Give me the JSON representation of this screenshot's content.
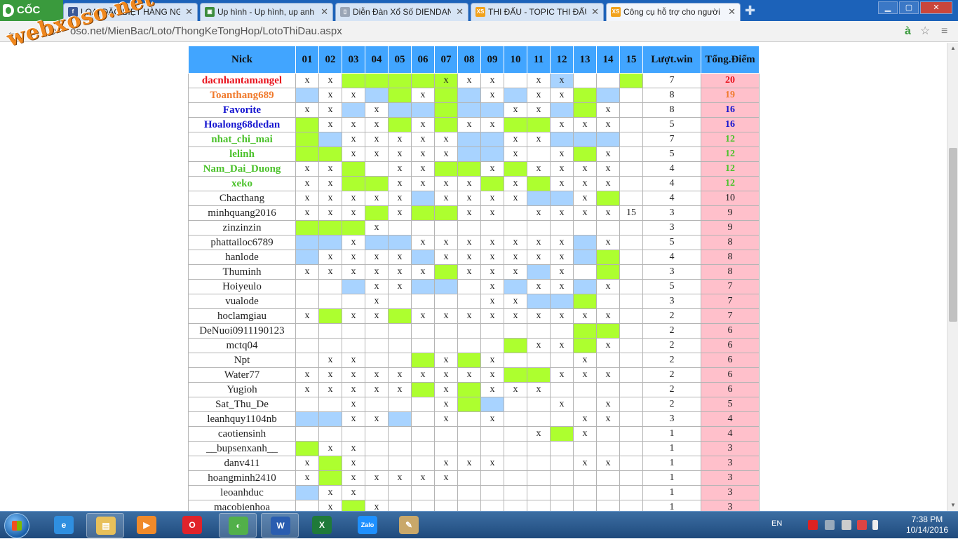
{
  "browser": {
    "brand": "CỐC CỐC",
    "tabs": [
      {
        "label": "LOẠI ĐẶC BIỆT HÀNG NGÀ",
        "icon": "facebook-icon",
        "color": "#3b5998",
        "glyph": "f"
      },
      {
        "label": "Up hình - Up hình, up anh",
        "icon": "image-icon",
        "color": "#3c8c3c",
        "glyph": "▣"
      },
      {
        "label": "Diễn Đàn Xổ Số DIENDAN",
        "icon": "page-icon",
        "color": "#9aa5b5",
        "glyph": "▯"
      },
      {
        "label": "THI ĐẤU - TOPIC THI ĐẤU",
        "icon": "xoso-icon",
        "color": "#f2a21b",
        "glyph": "XS"
      },
      {
        "label": "Công cụ hỗ trợ cho người",
        "icon": "xoso-icon",
        "color": "#f2a21b",
        "glyph": "XS",
        "active": true
      }
    ],
    "url": "oso.net/MienBac/Loto/ThongKeTongHop/LotoThiDau.aspx",
    "window": {
      "minimize": "▁",
      "maximize": "▢",
      "close": "✕"
    }
  },
  "watermark": "webxoso.net",
  "table": {
    "headers": [
      "Nick",
      "01",
      "02",
      "03",
      "04",
      "05",
      "06",
      "07",
      "08",
      "09",
      "10",
      "11",
      "12",
      "13",
      "14",
      "15",
      "Lượt.win",
      "Tổng.Điểm"
    ],
    "mark": "x",
    "rows": [
      {
        "nick": "dacnhantamangel",
        "color": "red",
        "cells": "xx....xxx.xx...",
        "fill": "..ggggg....b..g.",
        "win": "7",
        "score": "20"
      },
      {
        "nick": "Toanthang689",
        "color": "orange",
        "cells": ".xx..x..x.xx...",
        "fill": "b..bg.gb.b..gb..",
        "win": "8",
        "score": "19"
      },
      {
        "nick": "Favorite",
        "color": "blue",
        "cells": "xx.x.....xx..x.",
        "fill": "..b.bbgbb..bg...",
        "win": "8",
        "score": "16"
      },
      {
        "nick": "Hoalong68dedan",
        "color": "blue",
        "cells": ".xxx.x.xx..xxx.",
        "fill": "g...g.g..gg.....",
        "win": "5",
        "score": "16"
      },
      {
        "nick": "nhat_chi_mai",
        "color": "green",
        "cells": "..xxxxx..xx....",
        "fill": "gb.....bb..bbb..",
        "win": "7",
        "score": "12"
      },
      {
        "nick": "lelinh",
        "color": "green",
        "cells": "..xxxxx..x.x.x.",
        "fill": "gg.....bb...g...",
        "win": "5",
        "score": "12"
      },
      {
        "nick": "Nam_Dai_Duong",
        "color": "green",
        "cells": "xx..xx..x.xxxx.",
        "fill": "..g...gg.g......",
        "win": "4",
        "score": "12"
      },
      {
        "nick": "xeko",
        "color": "green",
        "cells": "xx..xxxx.x.xxx.",
        "fill": "..gg....g.g.....",
        "win": "4",
        "score": "12"
      },
      {
        "nick": "Chacthang",
        "color": "",
        "cells": "xxxxx.xxxx..x..",
        "fill": ".....b....bb.g..",
        "win": "4",
        "score": "10"
      },
      {
        "nick": "minhquang2016",
        "color": "",
        "cells": "xxx.x..xx.xxxx!",
        "fill": "...g.gg.........",
        "win": "3",
        "score": "9"
      },
      {
        "nick": "zinzinzin",
        "color": "",
        "cells": "...x...........",
        "fill": "ggg.............",
        "win": "3",
        "score": "9"
      },
      {
        "nick": "phattailoc6789",
        "color": "",
        "cells": "..x..xxxxxxx.x.",
        "fill": "bb.bb.......b...",
        "win": "5",
        "score": "8"
      },
      {
        "nick": "hanlode",
        "color": "",
        "cells": ".xxxx.xxxxxx...",
        "fill": "b....b......bg..",
        "win": "4",
        "score": "8"
      },
      {
        "nick": "Thuminh",
        "color": "",
        "cells": "xxxxxx.xxx.x...",
        "fill": "......g...b..g..",
        "win": "3",
        "score": "8"
      },
      {
        "nick": "Hoiyeulo",
        "color": "",
        "cells": "...xx...x.xx.x.",
        "fill": "..b..bb..b..b...",
        "win": "5",
        "score": "7"
      },
      {
        "nick": "vualode",
        "color": "",
        "cells": "...x....xx.....",
        "fill": "..........bbg...",
        "win": "3",
        "score": "7"
      },
      {
        "nick": "hoclamgiau",
        "color": "",
        "cells": "x.xx.xxxxxxxxx.",
        "fill": ".g..g...........",
        "win": "2",
        "score": "7"
      },
      {
        "nick": "DeNuoi0911190123",
        "color": "",
        "cells": "...............",
        "fill": "............gg..",
        "win": "2",
        "score": "6"
      },
      {
        "nick": "mctq04",
        "color": "",
        "cells": "..........xx.x.",
        "fill": ".........g..g...",
        "win": "2",
        "score": "6"
      },
      {
        "nick": "Npt",
        "color": "",
        "cells": ".xx...x.x...x..",
        "fill": ".....g.g........",
        "win": "2",
        "score": "6"
      },
      {
        "nick": "Water77",
        "color": "",
        "cells": "xxxxxxxxx..xxx.",
        "fill": ".........gg.....",
        "win": "2",
        "score": "6"
      },
      {
        "nick": "Yugioh",
        "color": "",
        "cells": "xxxxx.x.xxx....",
        "fill": ".....g.g........",
        "win": "2",
        "score": "6"
      },
      {
        "nick": "Sat_Thu_De",
        "color": "",
        "cells": "..x...x....x.x.",
        "fill": ".......gb.......",
        "win": "2",
        "score": "5"
      },
      {
        "nick": "leanhquy1104nb",
        "color": "",
        "cells": "..xx..x.x...xx.",
        "fill": "bb..b...........",
        "win": "3",
        "score": "4"
      },
      {
        "nick": "caotiensinh",
        "color": "",
        "cells": "..........x.x..",
        "fill": "...........g....",
        "win": "1",
        "score": "4"
      },
      {
        "nick": "__bupsenxanh__",
        "color": "",
        "cells": ".xx............",
        "fill": "g...............",
        "win": "1",
        "score": "3"
      },
      {
        "nick": "danv411",
        "color": "",
        "cells": "x.x...xxx...xx.",
        "fill": ".g..............",
        "win": "1",
        "score": "3"
      },
      {
        "nick": "hoangminh2410",
        "color": "",
        "cells": "x.xxxxx........",
        "fill": ".g..............",
        "win": "1",
        "score": "3"
      },
      {
        "nick": "leoanhduc",
        "color": "",
        "cells": ".xx............",
        "fill": "b...............",
        "win": "1",
        "score": "3"
      },
      {
        "nick": "macobienhoa",
        "color": "",
        "cells": ".x.x...........",
        "fill": "..g.............",
        "win": "1",
        "score": "3"
      }
    ]
  },
  "taskbar": {
    "apps": [
      {
        "name": "ie-icon",
        "color": "#2f8fe0",
        "glyph": "e"
      },
      {
        "name": "explorer-icon",
        "color": "#e8c05a",
        "glyph": "▤",
        "on": true
      },
      {
        "name": "media-player-icon",
        "color": "#f08a2a",
        "glyph": "▶"
      },
      {
        "name": "opera-icon",
        "color": "#e0232a",
        "glyph": "O"
      },
      {
        "name": "coccoc-icon",
        "color": "#52b04a",
        "glyph": "◐",
        "on": true
      },
      {
        "name": "word-icon",
        "color": "#2a5db0",
        "glyph": "W",
        "on": true
      },
      {
        "name": "excel-icon",
        "color": "#1f7a3a",
        "glyph": "X"
      },
      {
        "name": "zalo-icon",
        "color": "#1e90ff",
        "glyph": "Zalo"
      },
      {
        "name": "paint-icon",
        "color": "#c9a86a",
        "glyph": "✎"
      }
    ],
    "lang": "EN",
    "time": "7:38 PM",
    "date": "10/14/2016"
  }
}
